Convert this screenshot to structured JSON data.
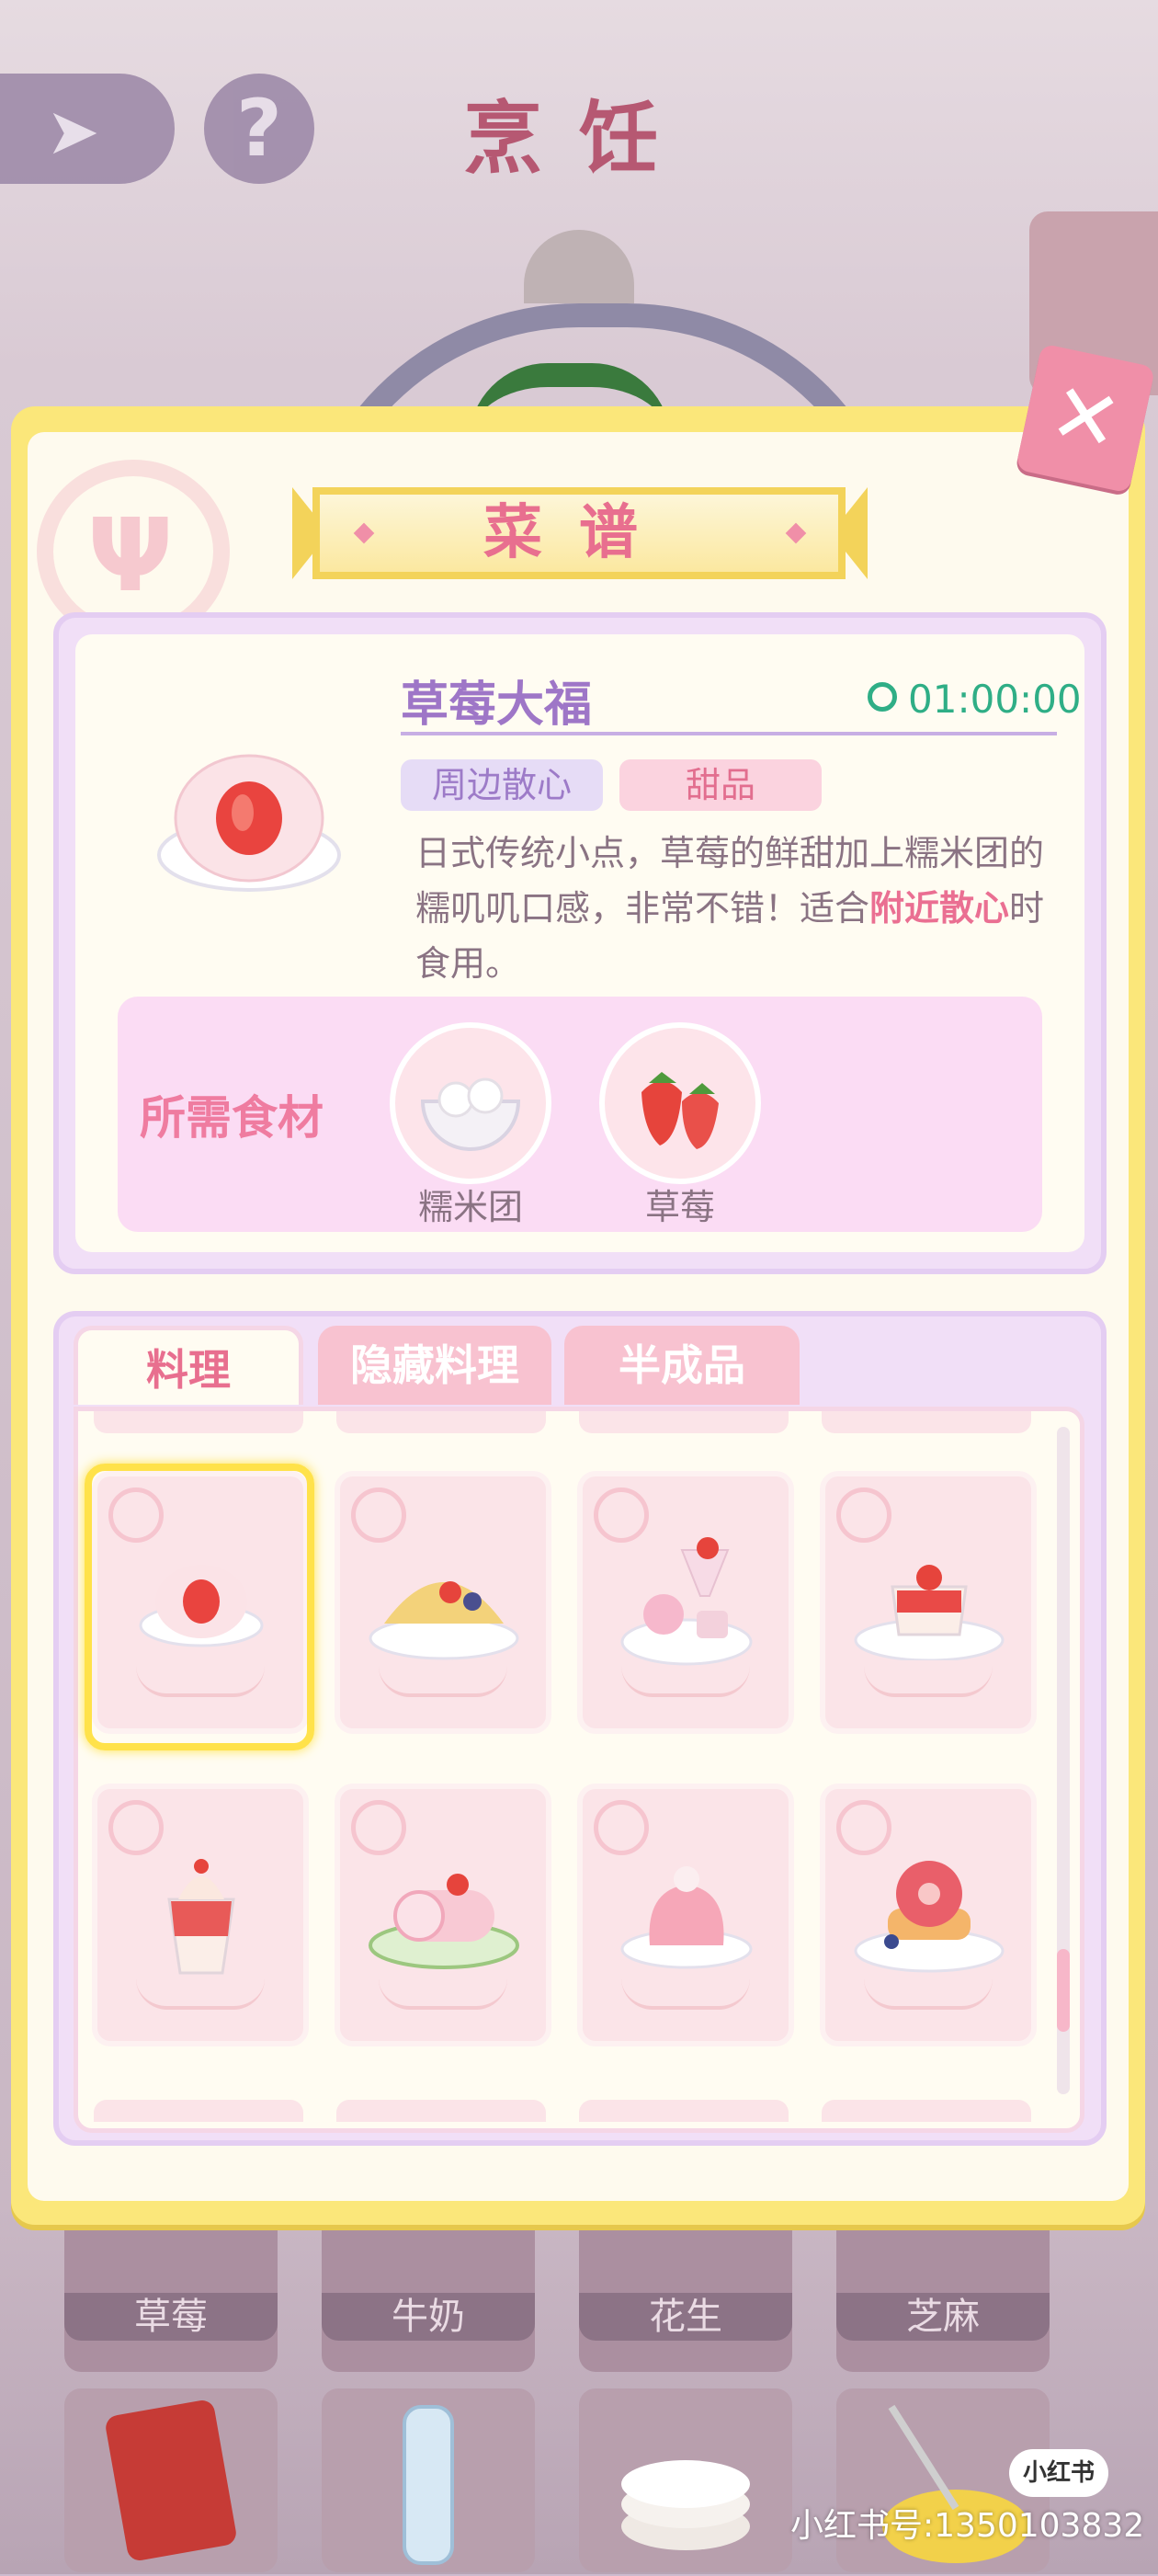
{
  "background": {
    "title": "烹饪",
    "help_symbol": "?",
    "ingredients_row1": [
      "草莓",
      "牛奶",
      "花生",
      "芝麻"
    ]
  },
  "dialog": {
    "banner_title": "菜谱",
    "close_symbol": "✕",
    "dish": {
      "name": "草莓大福",
      "timer": "01:00:00",
      "tags": [
        "周边散心",
        "甜品"
      ],
      "description_parts": [
        "日式传统小点，草莓的鲜甜加上糯米团的糯叽叽口感，非常不错！适合",
        "附近散心",
        "时食用。"
      ]
    },
    "ingredients": {
      "title": "所需食材",
      "items": [
        {
          "label": "糯米团",
          "icon": "rice-ball-bowl-icon"
        },
        {
          "label": "草莓",
          "icon": "strawberry-icon"
        }
      ]
    },
    "tabs": [
      "料理",
      "隐藏料理",
      "半成品"
    ],
    "active_tab": 0,
    "recipes": [
      {
        "icon": "strawberry-daifuku-icon",
        "selected": true
      },
      {
        "icon": "fruit-taco-icon",
        "selected": false
      },
      {
        "icon": "dessert-platter-icon",
        "selected": false
      },
      {
        "icon": "strawberry-pudding-icon",
        "selected": false
      },
      {
        "icon": "strawberry-sundae-icon",
        "selected": false
      },
      {
        "icon": "swiss-roll-icon",
        "selected": false
      },
      {
        "icon": "strawberry-jelly-icon",
        "selected": false
      },
      {
        "icon": "berry-pancake-icon",
        "selected": false
      }
    ]
  },
  "watermark": {
    "logo": "小红书",
    "text": "小红书号:1350103832"
  },
  "colors": {
    "dialog_border": "#fbe77a",
    "accent_pink": "#e86f8f",
    "accent_purple": "#9e76c7",
    "timer_green": "#2fae86"
  }
}
